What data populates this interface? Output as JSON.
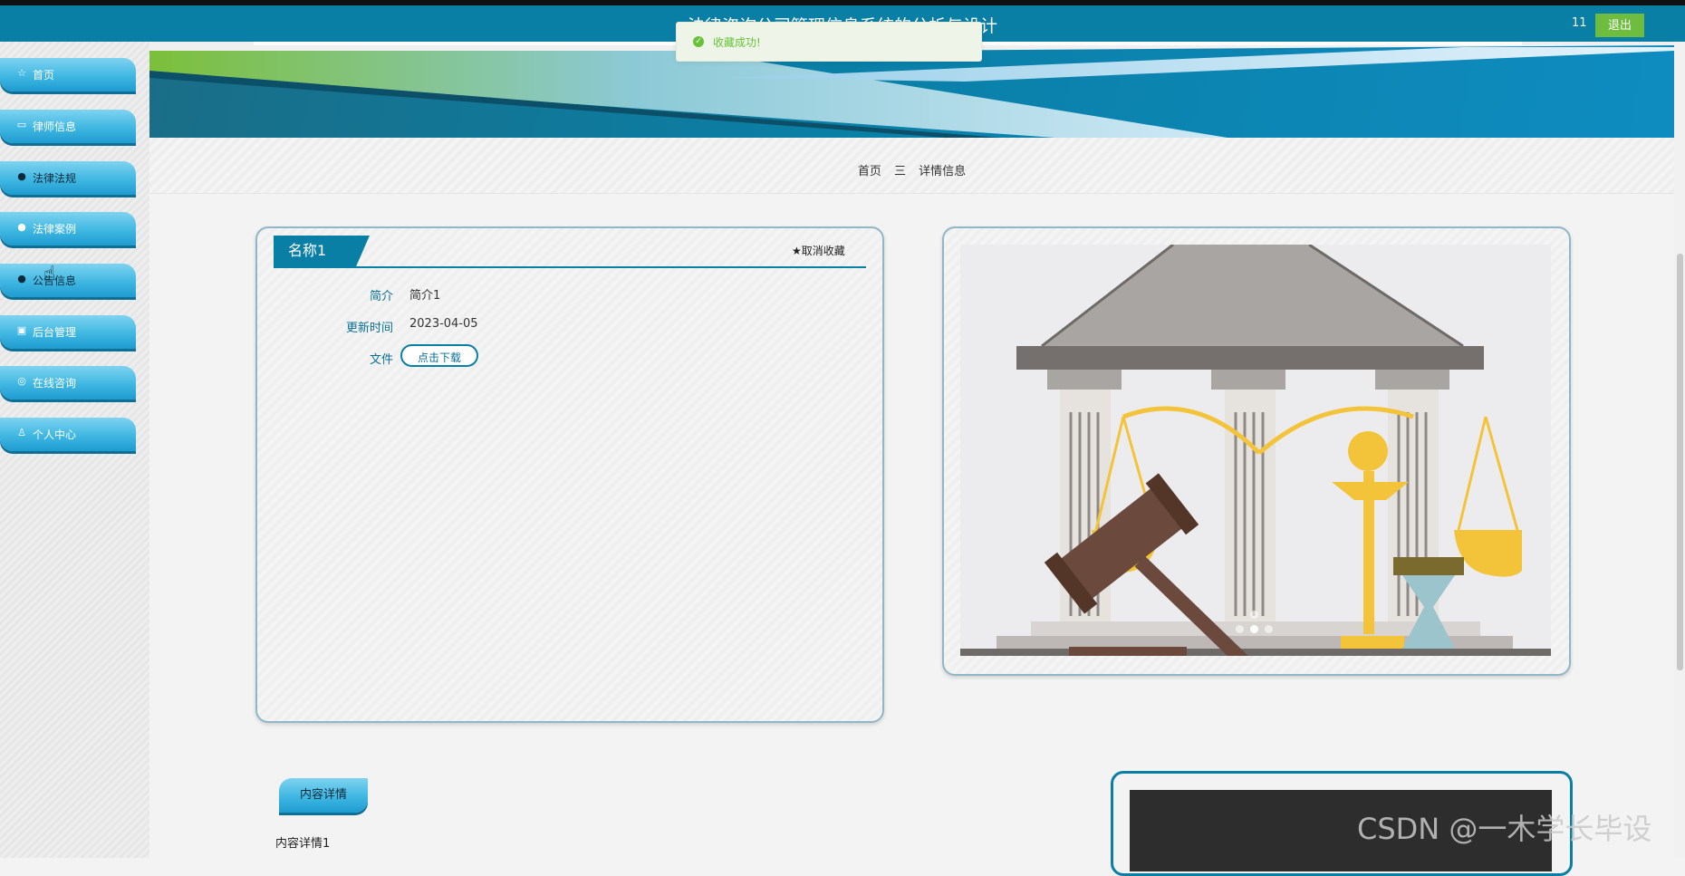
{
  "header": {
    "app_title": "法律咨询公司管理信息系统的分析与设计",
    "user_name": "11",
    "logout_label": "退出"
  },
  "toast": {
    "message": "收藏成功!"
  },
  "sidebar": {
    "items": [
      {
        "label": "首页",
        "icon": "star-outline-icon"
      },
      {
        "label": "律师信息",
        "icon": "briefcase-icon"
      },
      {
        "label": "法律法规",
        "icon": "info-circle-icon"
      },
      {
        "label": "法律案例",
        "icon": "question-circle-icon"
      },
      {
        "label": "公告信息",
        "icon": "info-italic-icon"
      },
      {
        "label": "后台管理",
        "icon": "calendar-box-icon"
      },
      {
        "label": "在线咨询",
        "icon": "headset-icon"
      },
      {
        "label": "个人中心",
        "icon": "user-icon"
      }
    ]
  },
  "breadcrumb": {
    "home": "首页",
    "separator": "三",
    "current": "详情信息"
  },
  "detail": {
    "name": "名称1",
    "unfavorite_label": "取消收藏",
    "fields": [
      {
        "label": "简介",
        "value": "简介1"
      },
      {
        "label": "更新时间",
        "value": "2023-04-05"
      },
      {
        "label": "文件",
        "button": "点击下载"
      }
    ]
  },
  "image_panel": {
    "image": "law-courthouse-scales-gavel",
    "carousel_dots": 3,
    "active_dot": 2
  },
  "content": {
    "tab_label": "内容详情",
    "text": "内容详情1"
  },
  "watermark": "CSDN @一木学长毕设",
  "colors": {
    "primary": "#0a7fa6",
    "logout": "#6ebd3f",
    "success": "#67c23a"
  }
}
